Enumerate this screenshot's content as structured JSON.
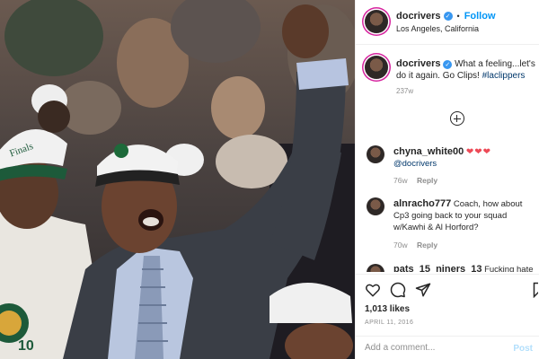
{
  "header": {
    "username": "docrivers",
    "verified_icon": "verified-badge-icon",
    "separator": "•",
    "follow_label": "Follow",
    "location": "Los Angeles, California"
  },
  "caption": {
    "username": "docrivers",
    "text": "What a feeling...let's do it again. Go Clips!",
    "hashtag": "#laclippers",
    "time": "237w"
  },
  "comments": [
    {
      "username": "chyna_white00",
      "hearts": "❤❤❤",
      "mention": "@docrivers",
      "time": "76w",
      "reply_label": "Reply"
    },
    {
      "username": "alnracho777",
      "text": "Coach, how about Cp3 going back to your squad w/Kawhi & Al Horford?",
      "time": "70w",
      "reply_label": "Reply"
    },
    {
      "username": "pats_15_niners_13",
      "text": "Fucking hate"
    }
  ],
  "actions": {
    "likes": "1,013 likes",
    "date": "APRIL 11, 2016",
    "comment_placeholder": "Add a comment...",
    "post_label": "Post",
    "icons": [
      "heart-icon",
      "comment-icon",
      "share-icon",
      "bookmark-icon"
    ]
  },
  "colors": {
    "follow": "#0095f6",
    "verified": "#3897f0",
    "heart": "#ed4956",
    "hashtag": "#00376b",
    "muted": "#8e8e8e"
  }
}
